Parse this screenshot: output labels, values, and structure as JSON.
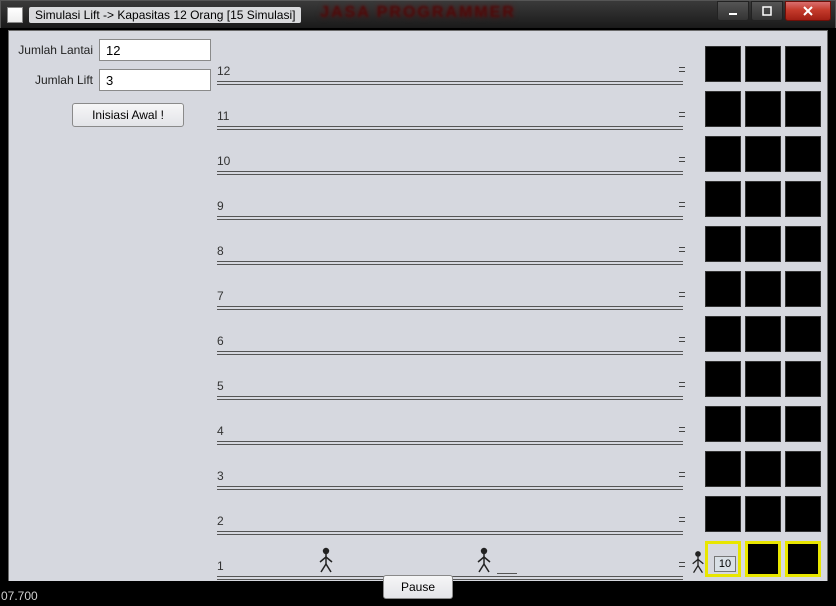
{
  "window": {
    "title": "Simulasi Lift -> Kapasitas 12 Orang [15 Simulasi]",
    "watermark": "JASA PROGRAMMER"
  },
  "form": {
    "floor_label": "Jumlah Lantai",
    "floor_value": "12",
    "lift_label": "Jumlah Lift",
    "lift_value": "3",
    "init_button": "Inisiasi Awal !"
  },
  "floors": [
    "12",
    "11",
    "10",
    "9",
    "8",
    "7",
    "6",
    "5",
    "4",
    "3",
    "2",
    "1"
  ],
  "ground_floor_count": "10",
  "lift_columns": 3,
  "footer": {
    "time": "07.700",
    "pause": "Pause"
  }
}
